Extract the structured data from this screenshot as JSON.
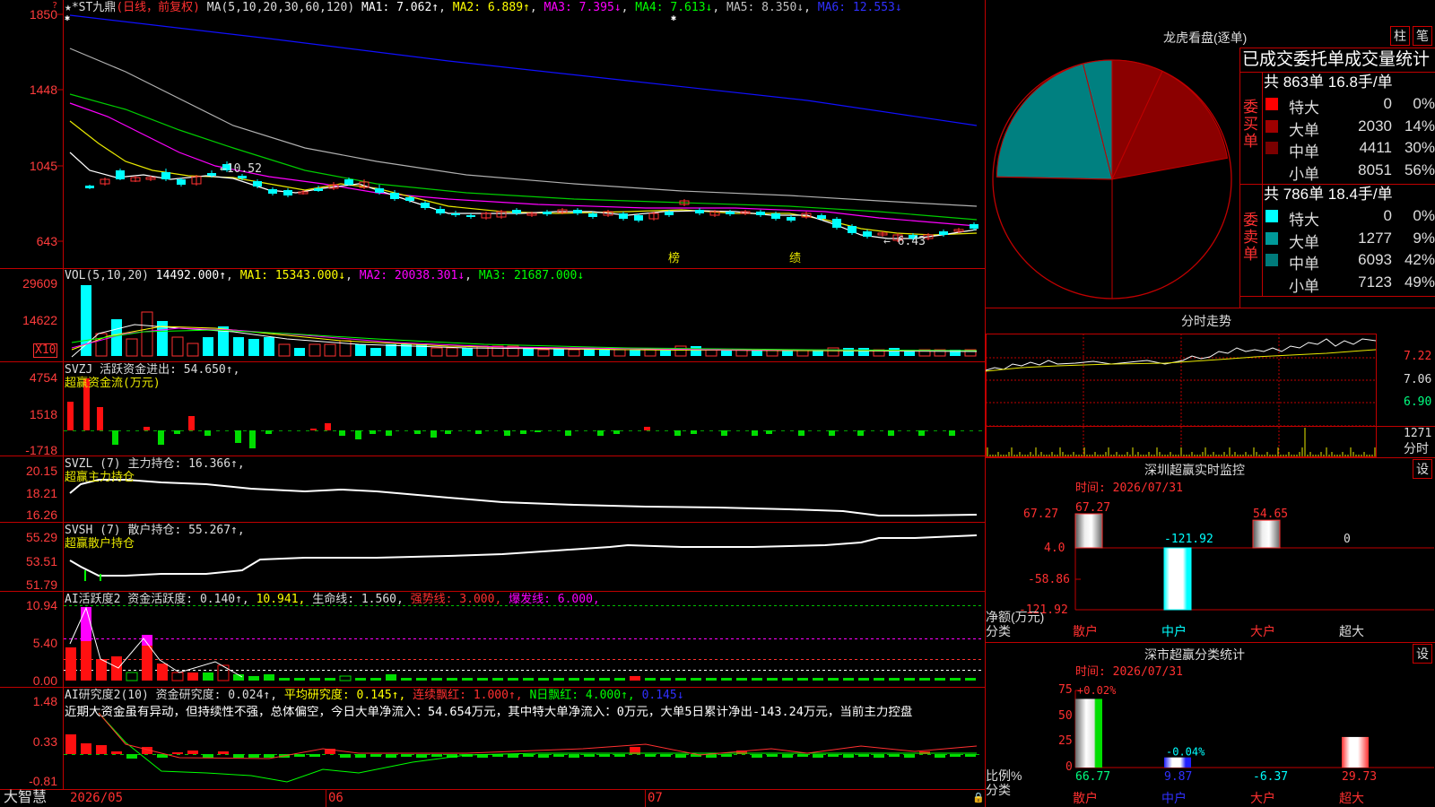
{
  "app": {
    "brand": "大智慧",
    "lock_icon": "lock-icon"
  },
  "kline": {
    "header": "★*ST九鼎",
    "period": "(日线，前复权)",
    "ma_params": "MA(5,10,20,30,60,120)",
    "ma_values": [
      {
        "label": "MA1: 7.062↑",
        "color": "#ffffff"
      },
      {
        "label": "MA2: 6.889↑",
        "color": "#ffff00"
      },
      {
        "label": "MA3: 7.395↓",
        "color": "#ff00ff"
      },
      {
        "label": "MA4: 7.613↓",
        "color": "#00ff00"
      },
      {
        "label": "MA5: 8.350↓",
        "color": "#c0c0c0"
      },
      {
        "label": "MA6: 12.553↓",
        "color": "#0000ff"
      }
    ],
    "y_ticks": [
      "1850",
      "1448",
      "1045",
      "643"
    ],
    "high_label": "←10.52",
    "low_label": "← 6.43",
    "markers": [
      "榜",
      "绩"
    ],
    "x_ticks": [
      "2026/05",
      "06",
      "07"
    ]
  },
  "vol": {
    "header": "VOL(5,10,20)",
    "value": "14492.000↑",
    "ma1": "MA1: 15343.000↓",
    "ma2": "MA2: 20038.301↓",
    "ma3": "MA3: 21687.000↓",
    "y_ticks": [
      "29609",
      "14622"
    ],
    "unit": "X10"
  },
  "svzj": {
    "header": "SVZJ  活跃资金进出: 54.650↑,",
    "sub": "超赢资金流(万元)",
    "y_ticks": [
      "4754",
      "1518",
      "-1718"
    ]
  },
  "svzl": {
    "header": "SVZL (7) 主力持仓: 16.366↑,",
    "sub": "超赢主力持仓",
    "y_ticks": [
      "20.15",
      "18.21",
      "16.26"
    ]
  },
  "svsh": {
    "header": "SVSH (7) 散户持仓: 55.267↑,",
    "sub": "超赢散户持仓",
    "y_ticks": [
      "55.29",
      "53.51",
      "51.79"
    ]
  },
  "ai_active": {
    "header": "AI活跃度2 资金活跃度: 0.140↑,",
    "v2": "10.941,",
    "v3": "生命线: 1.560,",
    "v4": "强势线: 3.000,",
    "v5": "爆发线: 6.000,",
    "y_ticks": [
      "10.94",
      "5.40",
      "0.00"
    ]
  },
  "ai_research": {
    "header": "AI研究度2(10) 资金研究度: 0.024↑,",
    "v2": "平均研究度: 0.145↑,",
    "v3": "连续飘红: 1.000↑,",
    "v4": "N日飘红: 4.000↑,",
    "v5": "0.145↓",
    "comment": "近期大资金虽有异动，但持续性不强，总体偏空，今日大单净流入：54.654万元，其中特大单净流入：0万元，大单5日累计净出-143.24万元，当前主力控盘",
    "y_ticks": [
      "1.48",
      "0.33",
      "-0.81"
    ]
  },
  "dragon": {
    "title": "龙虎看盘(逐单)",
    "btn1": "柱",
    "btn2": "笔",
    "table_title": "已成交委托单成交量统计",
    "buy_label": "委买单",
    "sell_label": "委卖单",
    "buy_summary": "共 863单 16.8手/单",
    "sell_summary": "共 786单 18.4手/单",
    "buy_rows": [
      {
        "name": "特大",
        "value": "0",
        "pct": "0%",
        "color": "#ff0000"
      },
      {
        "name": "大单",
        "value": "2030",
        "pct": "14%",
        "color": "#a00000"
      },
      {
        "name": "中单",
        "value": "4411",
        "pct": "30%",
        "color": "#7a0000"
      },
      {
        "name": "小单",
        "value": "8051",
        "pct": "56%",
        "color": "#000000"
      }
    ],
    "sell_rows": [
      {
        "name": "特大",
        "value": "0",
        "pct": "0%",
        "color": "#00ffff"
      },
      {
        "name": "大单",
        "value": "1277",
        "pct": "9%",
        "color": "#009999"
      },
      {
        "name": "中单",
        "value": "6093",
        "pct": "42%",
        "color": "#007a7a"
      },
      {
        "name": "小单",
        "value": "7123",
        "pct": "49%",
        "color": "#000000"
      }
    ]
  },
  "intraday": {
    "title": "分时走势",
    "y_ticks": [
      "7.22",
      "7.06",
      "6.90"
    ],
    "vol_tick": "1271",
    "vol_unit": "分时"
  },
  "sz_monitor": {
    "title": "深圳超赢实时监控",
    "btn": "设",
    "time": "时间: 2026/07/31",
    "y_ticks": [
      "67.27",
      "4.0",
      "-58.86",
      "-121.92"
    ],
    "axis_label1": "净额(万元)",
    "axis_label2": "分类",
    "categories": [
      "散户",
      "中户",
      "大户",
      "超大"
    ],
    "values": [
      67.27,
      -121.92,
      54.65,
      0
    ],
    "value_labels": [
      "67.27",
      "-121.92",
      "54.65",
      "0"
    ]
  },
  "sz_class": {
    "title": "深市超赢分类统计",
    "btn": "设",
    "time": "时间: 2026/07/31",
    "y_ticks": [
      "75",
      "50",
      "25",
      "0"
    ],
    "axis_label1": "比例%",
    "axis_label2": "分类",
    "categories": [
      "散户",
      "中户",
      "大户",
      "超大"
    ],
    "values": [
      66.77,
      9.87,
      -6.37,
      29.73
    ],
    "value_labels": [
      "66.77",
      "9.87",
      "-6.37",
      "29.73"
    ],
    "change_labels": [
      "+0.02%",
      "-0.04%",
      "",
      ""
    ]
  }
}
